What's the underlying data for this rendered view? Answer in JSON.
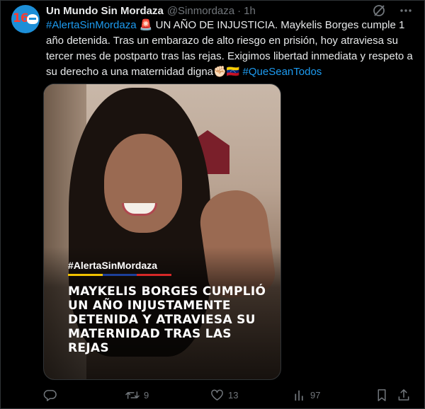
{
  "account": {
    "avatar_text": "16",
    "display_name": "Un Mundo Sin Mordaza",
    "handle": "@Sinmordaza",
    "separator": "·",
    "time": "1h"
  },
  "tweet": {
    "hashtag_1": "#AlertaSinMordaza",
    "alert_emoji": "🚨",
    "body": " UN AÑO DE INJUSTICIA. Maykelis Borges cumple 1 año detenida. Tras un embarazo de alto riesgo en prisión, hoy atraviesa su tercer mes de postparto tras las rejas. Exigimos libertad inmediata y respeto a su derecho a una maternidad digna",
    "emojis": "✊🏻🇻🇪",
    "hashtag_2": "#QueSeanTodos"
  },
  "media": {
    "overlay_hashtag": "#AlertaSinMordaza",
    "overlay_headline": "MAYKELIS BORGES CUMPLIÓ UN AÑO INJUSTAMENTE DETENIDA Y ATRAVIESA SU MATERNIDAD TRAS LAS REJAS",
    "flag_colors": [
      "#f2c200",
      "#1d3f9a",
      "#d62828"
    ]
  },
  "actions": {
    "reply": {
      "icon": "reply-icon",
      "count": ""
    },
    "repost": {
      "icon": "repost-icon",
      "count": "9"
    },
    "like": {
      "icon": "heart-icon",
      "count": "13"
    },
    "views": {
      "icon": "views-icon",
      "count": "97"
    },
    "bookmark": {
      "icon": "bookmark-icon"
    },
    "share": {
      "icon": "share-icon"
    }
  },
  "colors": {
    "accent": "#1d9bf0",
    "muted": "#71767b",
    "text": "#e7e9ea",
    "background": "#000000"
  }
}
